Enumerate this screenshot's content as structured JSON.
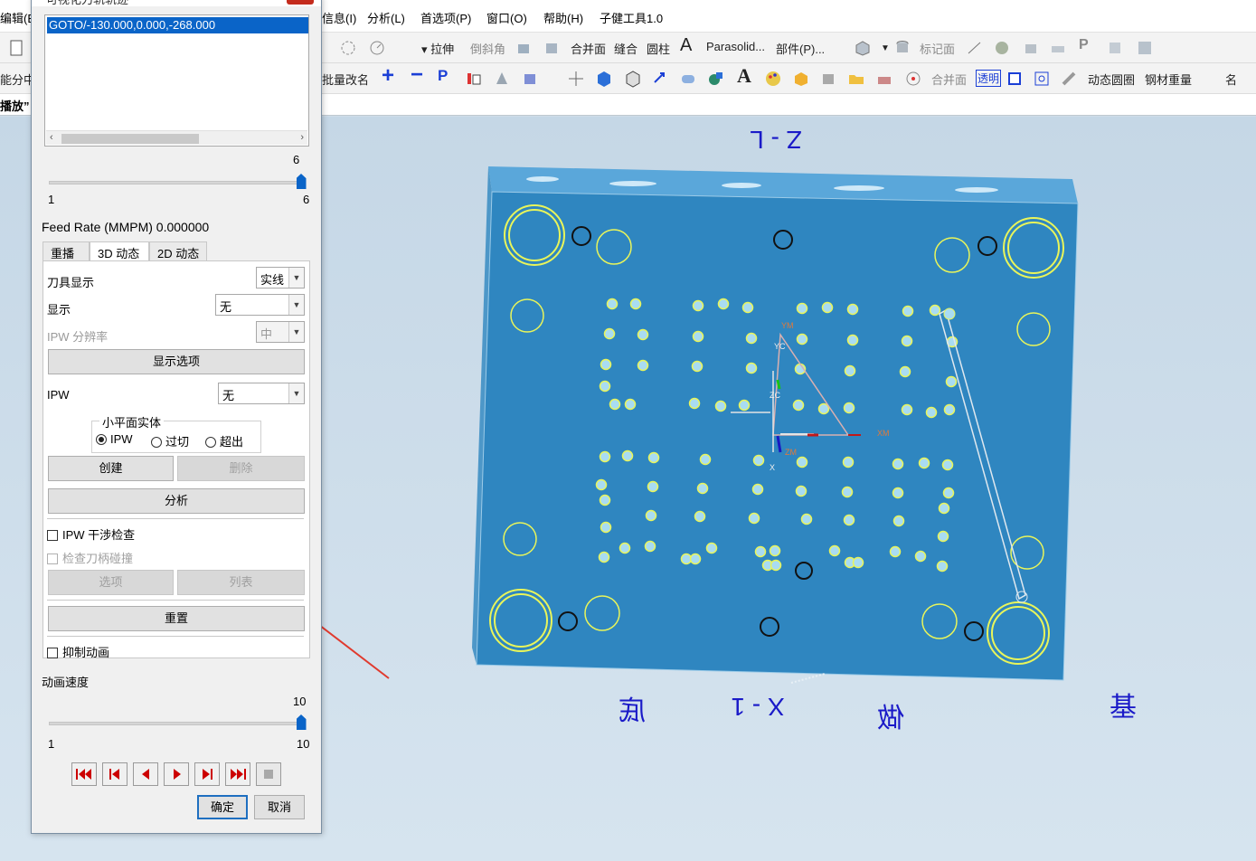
{
  "menu": {
    "edit_partial": "编辑(E)",
    "info": "信息(I)",
    "analysis": "分析(L)",
    "preferences": "首选项(P)",
    "window": "窗口(O)",
    "help": "帮助(H)",
    "plugin": "子健工具1.0"
  },
  "toolbar1": {
    "extrude": "拉伸",
    "chamfer": "倒斜角",
    "unite_face": "合并面",
    "sew": "缝合",
    "cylinder": "圆柱",
    "parasolid": "Parasolid...",
    "part": "部件(P)...",
    "mark_note": "标记面"
  },
  "toolbar2": {
    "smart_split_partial": "能分中",
    "batch_rename": "批量改名",
    "unite_face": "合并面",
    "transparent": "透明",
    "dynamic_circle": "动态圆圈",
    "steel_weight": "钢材重量",
    "name_partial": "名"
  },
  "row3": {
    "play_partial": "播放”"
  },
  "dialog": {
    "close_label": "✕",
    "title_partial": "可视化刀轨轨迹",
    "goto_entry": "GOTO/-130.000,0.000,-268.000",
    "scroll_left": "‹",
    "scroll_right": "›",
    "step_slider": {
      "value": "6",
      "min": "1",
      "max": "6",
      "fraction": 1.0
    },
    "feed_rate": "Feed Rate (MMPM) 0.000000",
    "tabs": [
      "重播",
      "3D 动态",
      "2D 动态"
    ],
    "tool_display_label": "刀具显示",
    "tool_display_value": "实线",
    "display_label": "显示",
    "display_value": "无",
    "ipw_resolution_label": "IPW 分辨率",
    "ipw_resolution_value": "中",
    "display_options_button": "显示选项",
    "ipw_label": "IPW",
    "ipw_value": "无",
    "facet_solid_group": "小平面实体",
    "radio_ipw": "IPW",
    "radio_overcut": "过切",
    "radio_excess": "超出",
    "create_button": "创建",
    "delete_button": "删除",
    "analyze_button": "分析",
    "ipw_collision_check": "IPW 干涉检查",
    "check_holder_collision": "检查刀柄碰撞",
    "options_button": "选项",
    "list_button": "列表",
    "reset_button": "重置",
    "suppress_animation": "抑制动画",
    "anim_speed_label": "动画速度",
    "speed_slider": {
      "value": "10",
      "min": "1",
      "max": "10",
      "fraction": 1.0
    },
    "ok_button": "确定",
    "cancel_button": "取消"
  },
  "viewport": {
    "label_top": "Z - L",
    "label_bottom": "X - 1",
    "label_bottom_left": "底",
    "label_bottom_mid": "做",
    "label_bottom_right": "基",
    "axis_labels": {
      "ym": "YM",
      "yc": "YC",
      "zc": "ZC",
      "xm": "XM",
      "zm": "ZM",
      "x": "X"
    }
  },
  "colors": {
    "plate": "#2f86c0",
    "plate_side": "#5aa7da",
    "hole_ring": "#e9f55a",
    "hole_fill": "#a9dcf2",
    "selection": "#0a64c8",
    "annotation_arrow": "#e03a2e",
    "view_label": "#1a1ac8"
  }
}
